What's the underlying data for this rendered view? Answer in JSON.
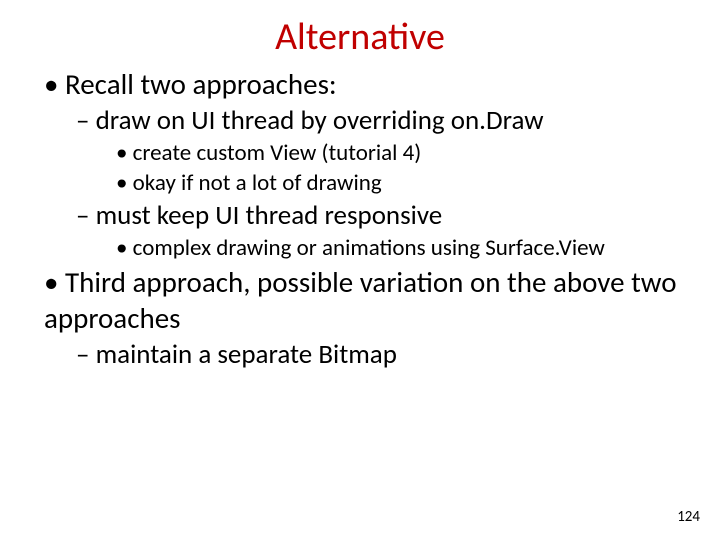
{
  "title": "Alternative",
  "bullets": {
    "b1": "Recall two approaches:",
    "b1a": "draw on UI thread by overriding on.Draw",
    "b1a_i": "create custom View (tutorial 4)",
    "b1a_ii": "okay if not a lot of drawing",
    "b1b": "must keep UI thread responsive",
    "b1b_i": "complex drawing or animations using Surface.View",
    "b2": "Third approach, possible variation on the above two approaches",
    "b2a": "maintain a separate Bitmap"
  },
  "page_number": "124"
}
